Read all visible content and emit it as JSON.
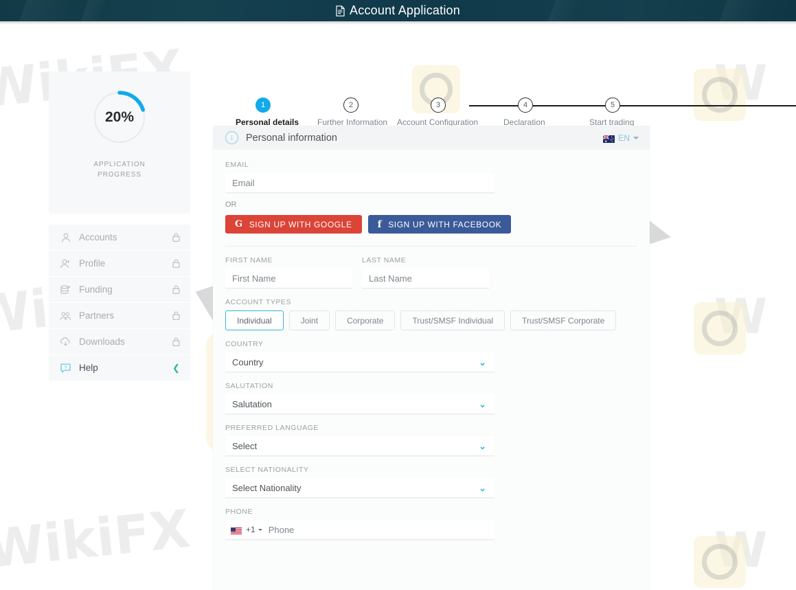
{
  "topbar": {
    "title": "Account Application",
    "icon": "document-icon"
  },
  "sidebar": {
    "progress": {
      "percent_label": "20%",
      "percent_value": 20,
      "caption_line1": "APPLICATION",
      "caption_line2": "PROGRESS",
      "ring_color": "#12aaeb",
      "track_color": "#e3e6e8"
    },
    "items": [
      {
        "label": "Accounts",
        "icon": "user-icon",
        "right_icon": "lock-icon",
        "locked": true
      },
      {
        "label": "Profile",
        "icon": "user-plus-icon",
        "right_icon": "lock-icon",
        "locked": true
      },
      {
        "label": "Funding",
        "icon": "coins-plus-icon",
        "right_icon": "lock-icon",
        "locked": true
      },
      {
        "label": "Partners",
        "icon": "users-icon",
        "right_icon": "lock-icon",
        "locked": true
      },
      {
        "label": "Downloads",
        "icon": "cloud-download-icon",
        "right_icon": "lock-icon",
        "locked": true
      },
      {
        "label": "Help",
        "icon": "help-bubble-icon",
        "right_icon": "chevron-left-icon",
        "locked": false
      }
    ]
  },
  "stepper": {
    "active_index": 0,
    "steps": [
      {
        "number": "1",
        "label": "Personal details"
      },
      {
        "number": "2",
        "label": "Further Information"
      },
      {
        "number": "3",
        "label": "Account Configuration"
      },
      {
        "number": "4",
        "label": "Declaration"
      },
      {
        "number": "5",
        "label": "Start trading"
      }
    ]
  },
  "card": {
    "title": "Personal information",
    "info_icon": "info-circle-icon",
    "language": {
      "code": "EN",
      "flag": "australia-flag",
      "caret": "caret-down-icon"
    },
    "fields": {
      "email_label": "EMAIL",
      "email_placeholder": "Email",
      "or_text": "OR",
      "google_button": "SIGN UP WITH GOOGLE",
      "facebook_button": "SIGN UP WITH FACEBOOK",
      "google_color": "#db4437",
      "facebook_color": "#3b5a9a",
      "first_name_label": "FIRST NAME",
      "first_name_placeholder": "First Name",
      "last_name_label": "LAST NAME",
      "last_name_placeholder": "Last Name",
      "account_types_label": "ACCOUNT TYPES",
      "account_types": [
        {
          "label": "Individual",
          "selected": true
        },
        {
          "label": "Joint",
          "selected": false
        },
        {
          "label": "Corporate",
          "selected": false
        },
        {
          "label": "Trust/SMSF Individual",
          "selected": false
        },
        {
          "label": "Trust/SMSF Corporate",
          "selected": false
        }
      ],
      "country_label": "COUNTRY",
      "country_value": "Country",
      "salutation_label": "SALUTATION",
      "salutation_value": "Salutation",
      "language_label": "PREFERRED LANGUAGE",
      "language_value": "Select",
      "nationality_label": "SELECT NATIONALITY",
      "nationality_value": "Select Nationality",
      "phone_label": "PHONE",
      "phone_country_code": "+1",
      "phone_flag": "usa-flag",
      "phone_placeholder": "Phone"
    }
  },
  "watermarks": {
    "text": "WikiFX",
    "brand": "W"
  }
}
